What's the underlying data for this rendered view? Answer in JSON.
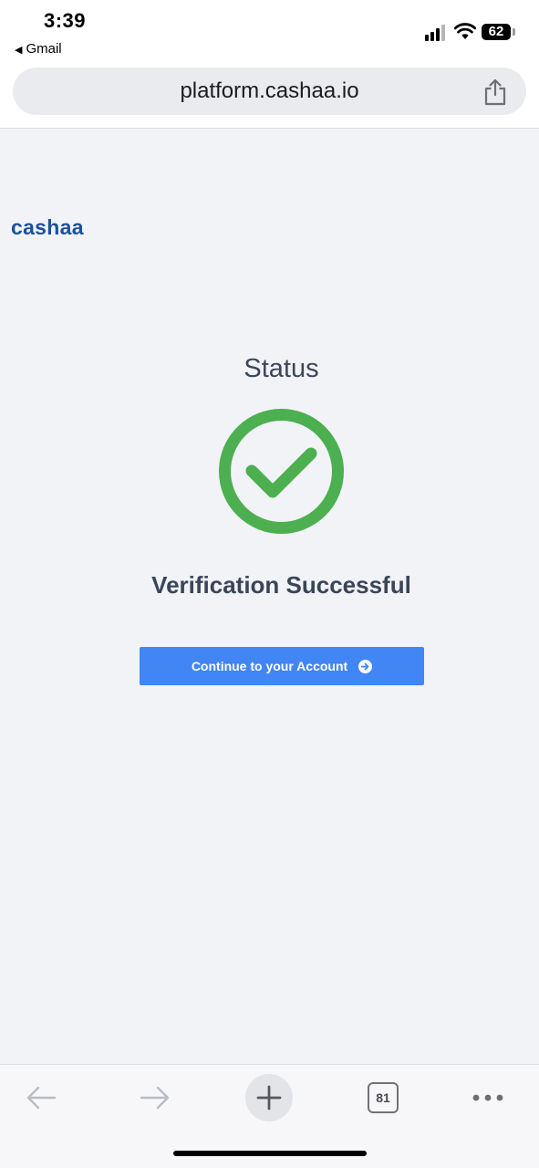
{
  "status_bar": {
    "time": "3:39",
    "back_app": "Gmail",
    "battery": "62"
  },
  "browser": {
    "url": "platform.cashaa.io",
    "tab_count": "81"
  },
  "page": {
    "brand": "cashaa",
    "status_title": "Status",
    "heading": "Verification Successful",
    "continue_label": "Continue to your Account"
  },
  "colors": {
    "brand": "#1d4f9c",
    "success": "#4caf50",
    "button": "#4285f4",
    "heading": "#3a4559"
  },
  "icons": {
    "success": "check-circle-icon",
    "button_arrow": "arrow-circle-right-icon",
    "share": "share-icon",
    "back": "arrow-left-icon",
    "forward": "arrow-right-icon",
    "new_tab": "plus-icon",
    "tabs": "tabs-icon",
    "menu": "more-dots-icon"
  }
}
